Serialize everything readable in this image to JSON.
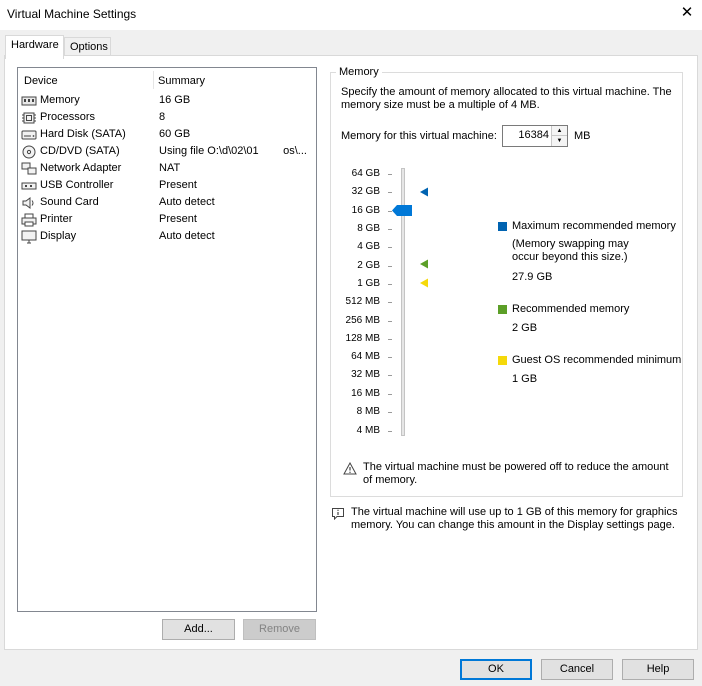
{
  "window": {
    "title": "Virtual Machine Settings",
    "close_glyph": "✕"
  },
  "tabs": [
    {
      "label": "Hardware"
    },
    {
      "label": "Options"
    }
  ],
  "device_list": {
    "headers": {
      "device": "Device",
      "summary": "Summary"
    },
    "rows": [
      {
        "device": "Memory",
        "summary": "16 GB",
        "icon": "memory-icon"
      },
      {
        "device": "Processors",
        "summary": "8",
        "icon": "processor-icon"
      },
      {
        "device": "Hard Disk (SATA)",
        "summary": "60 GB",
        "icon": "hard-disk-icon"
      },
      {
        "device": "CD/DVD (SATA)",
        "summary": "Using file O:\\d\\02\\01        os\\...",
        "icon": "cd-dvd-icon"
      },
      {
        "device": "Network Adapter",
        "summary": "NAT",
        "icon": "network-adapter-icon"
      },
      {
        "device": "USB Controller",
        "summary": "Present",
        "icon": "usb-icon"
      },
      {
        "device": "Sound Card",
        "summary": "Auto detect",
        "icon": "speaker-icon"
      },
      {
        "device": "Printer",
        "summary": "Present",
        "icon": "printer-icon"
      },
      {
        "device": "Display",
        "summary": "Auto detect",
        "icon": "display-icon"
      }
    ],
    "selected_index": 0,
    "add_button": "Add...",
    "remove_button": "Remove"
  },
  "memory": {
    "group_title": "Memory",
    "description": "Specify the amount of memory allocated to this virtual machine. The memory size must be a multiple of 4 MB.",
    "field_label": "Memory for this virtual machine:",
    "field_value": "16384",
    "field_unit": "MB",
    "scale_labels": [
      "64 GB",
      "32 GB",
      "16 GB",
      "8 GB",
      "4 GB",
      "2 GB",
      "1 GB",
      "512 MB",
      "256 MB",
      "128 MB",
      "64 MB",
      "32 MB",
      "16 MB",
      "8 MB",
      "4 MB"
    ],
    "current_level": "16 GB",
    "legend": {
      "max_label": "Maximum recommended memory",
      "max_note": "(Memory swapping may occur beyond this size.)",
      "max_value": "27.9 GB",
      "rec_label": "Recommended memory",
      "rec_value": "2 GB",
      "min_label": "Guest OS recommended minimum",
      "min_value": "1 GB"
    },
    "warning": "The virtual machine must be powered off to reduce the amount of memory.",
    "info": "The virtual machine will use up to 1 GB of this memory for graphics memory. You can change this amount in the Display settings page."
  },
  "colors": {
    "max": "#0063b1",
    "recommended": "#5c9f28",
    "minimum": "#f5d90a",
    "thumb": "#0078d7"
  },
  "footer": {
    "ok": "OK",
    "cancel": "Cancel",
    "help": "Help"
  }
}
